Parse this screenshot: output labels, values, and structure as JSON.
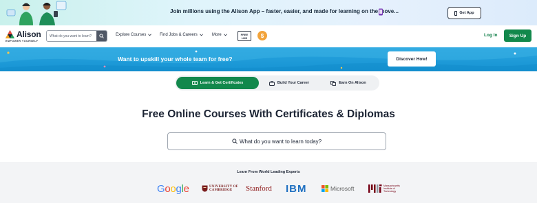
{
  "promo": {
    "text": "Join millions using the Alison App – faster, easier, and made for learning on the move...",
    "button_label": "Get App"
  },
  "nav": {
    "logo_text": "Alison",
    "logo_tagline": "EMPOWER YOURSELF",
    "search_placeholder": "What do you want to learn?",
    "menu": [
      "Explore Courses",
      "Find Jobs & Careers",
      "More"
    ],
    "lms_badge": [
      "FREE",
      "LMS"
    ],
    "coin_symbol": "$",
    "login_label": "Log In",
    "signup_label": "Sign Up"
  },
  "banner": {
    "text": "Want to upskill your whole team for free?",
    "button_label": "Discover How!"
  },
  "tabs": [
    {
      "label": "Learn & Get Certificates",
      "active": true
    },
    {
      "label": "Build Your Career",
      "active": false
    },
    {
      "label": "Earn On Alison",
      "active": false
    }
  ],
  "hero": {
    "title": "Free Online Courses With Certificates & Diplomas",
    "search_placeholder": "What do you want to learn today?"
  },
  "partners": {
    "title": "Learn From World Leading Experts",
    "logos": [
      "Google",
      "UNIVERSITY OF CAMBRIDGE",
      "Stanford",
      "IBM",
      "Microsoft",
      "Massachusetts Institute of Technology"
    ]
  },
  "colors": {
    "brand_green": "#12884c",
    "banner_blue": "#1c9ad8",
    "coin_orange": "#f2a33a"
  }
}
